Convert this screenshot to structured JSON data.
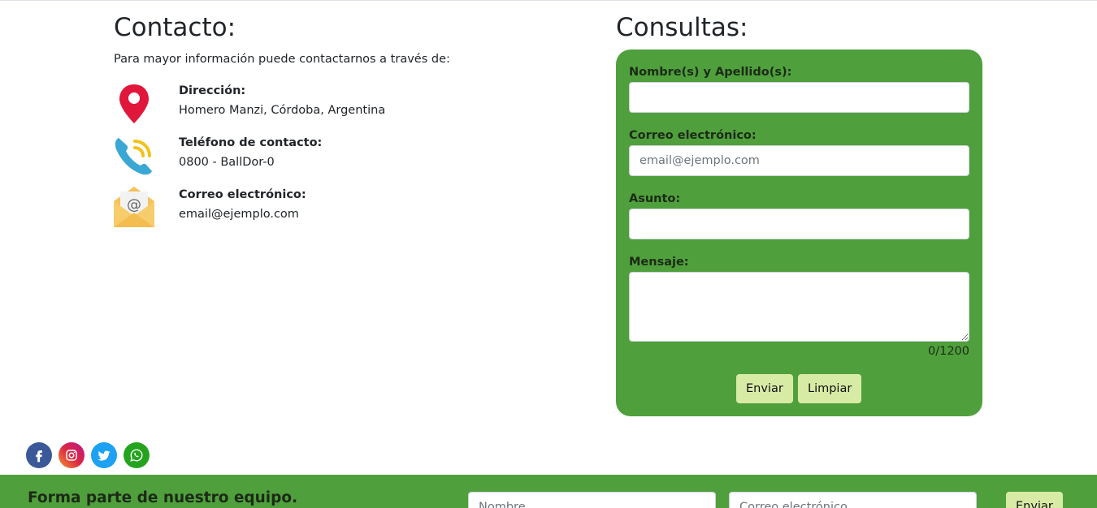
{
  "contact": {
    "title": "Contacto:",
    "intro": "Para mayor información puede contactarnos a través de:",
    "items": [
      {
        "icon": "map-pin-icon",
        "label": "Dirección:",
        "value": "Homero Manzi, Córdoba, Argentina"
      },
      {
        "icon": "phone-icon",
        "label": "Teléfono de contacto:",
        "value": "0800 - BallDor-0"
      },
      {
        "icon": "envelope-icon",
        "label": "Correo electrónico:",
        "value": "email@ejemplo.com"
      }
    ]
  },
  "consultas": {
    "title": "Consultas:",
    "fields": {
      "name_label": "Nombre(s) y Apellido(s):",
      "name_value": "",
      "email_label": "Correo electrónico:",
      "email_placeholder": "email@ejemplo.com",
      "subject_label": "Asunto:",
      "subject_value": "",
      "message_label": "Mensaje:",
      "message_value": ""
    },
    "counter": "0/1200",
    "send_label": "Enviar",
    "clear_label": "Limpiar"
  },
  "social": [
    "facebook-icon",
    "instagram-icon",
    "twitter-icon",
    "whatsapp-icon"
  ],
  "footer": {
    "title": "Forma parte de nuestro equipo.",
    "name_placeholder": "Nombre",
    "email_placeholder": "Correo electrónico",
    "send_label": "Enviar"
  },
  "colors": {
    "green": "#4fa03c",
    "button": "#d8eba5",
    "pin": "#e0173b",
    "phone": "#3aa7d4",
    "envelope": "#f5c25c"
  }
}
